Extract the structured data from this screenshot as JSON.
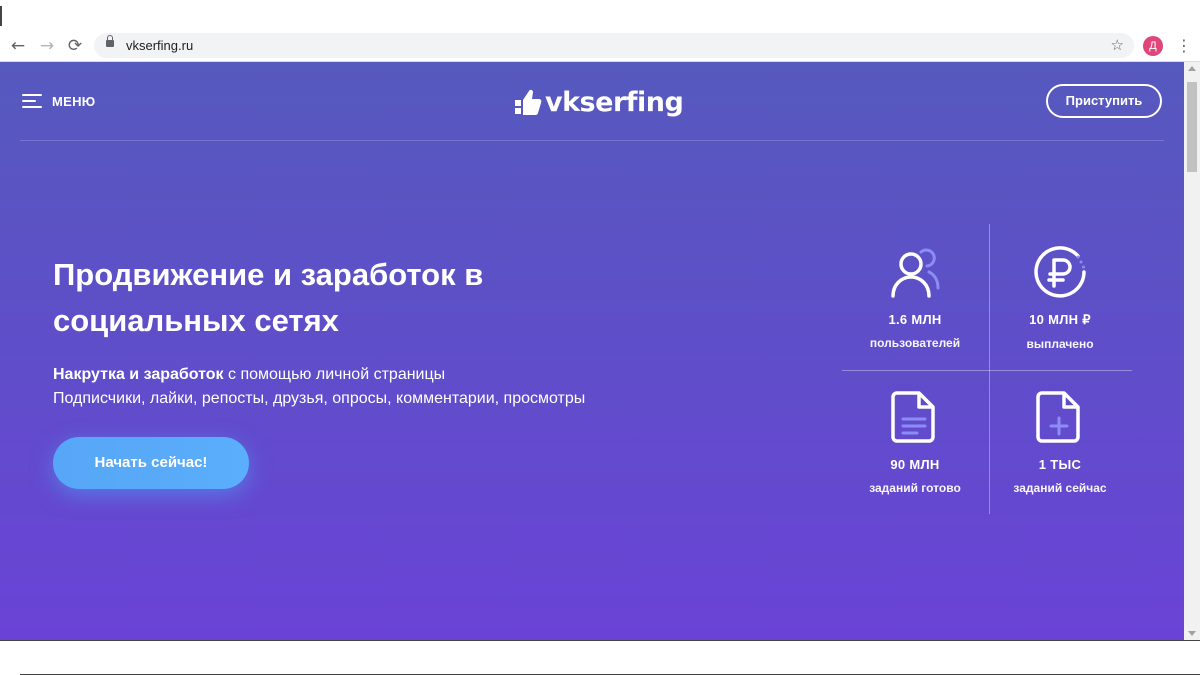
{
  "browser": {
    "url": "vkserfing.ru",
    "profile_initial": "Д",
    "back_glyph": "←",
    "forward_glyph": "→",
    "reload_glyph": "⟳",
    "star_glyph": "☆",
    "kebab_glyph": "⋮"
  },
  "header": {
    "menu_label": "МЕНЮ",
    "logo_text": "vkserfing",
    "start_button": "Приступить"
  },
  "hero": {
    "title": "Продвижение и заработок в социальных сетях",
    "subtitle_bold": "Накрутка и заработок",
    "subtitle_rest": " с помощью личной страницы",
    "subtitle_line2": "Подписчики, лайки, репосты, друзья, опросы, комментарии, просмотры",
    "cta_label": "Начать сейчас!"
  },
  "stats": [
    {
      "icon": "users-icon",
      "value": "1.6 МЛН",
      "label": "пользователей"
    },
    {
      "icon": "ruble-coin-icon",
      "value": "10 МЛН ₽",
      "label": "выплачено"
    },
    {
      "icon": "document-lines-icon",
      "value": "90 МЛН",
      "label": "заданий готово"
    },
    {
      "icon": "document-plus-icon",
      "value": "1 ТЫС",
      "label": "заданий сейчас"
    }
  ],
  "colors": {
    "gradient_top": "#5659be",
    "gradient_bottom": "#6a43d6",
    "cta": "#57a6f7",
    "icon_accent": "#8d8cf6"
  }
}
